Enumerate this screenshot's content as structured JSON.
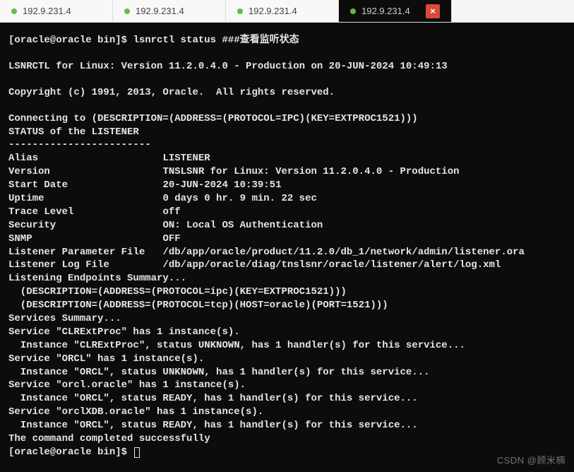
{
  "tabs": [
    {
      "label": "192.9.231.4",
      "active": false
    },
    {
      "label": "192.9.231.4",
      "active": false
    },
    {
      "label": "192.9.231.4",
      "active": false
    },
    {
      "label": "192.9.231.4",
      "active": true
    }
  ],
  "close_glyph": "×",
  "prompt": "[oracle@oracle bin]$ ",
  "command": "lsnrctl status ###查看监听状态",
  "lines": {
    "l1": "LSNRCTL for Linux: Version 11.2.0.4.0 - Production on 20-JUN-2024 10:49:13",
    "l2": "Copyright (c) 1991, 2013, Oracle.  All rights reserved.",
    "l3": "Connecting to (DESCRIPTION=(ADDRESS=(PROTOCOL=IPC)(KEY=EXTPROC1521)))",
    "l4": "STATUS of the LISTENER",
    "l5": "------------------------",
    "r1a": "Alias",
    "r1b": "LISTENER",
    "r2a": "Version",
    "r2b": "TNSLSNR for Linux: Version 11.2.0.4.0 - Production",
    "r3a": "Start Date",
    "r3b": "20-JUN-2024 10:39:51",
    "r4a": "Uptime",
    "r4b": "0 days 0 hr. 9 min. 22 sec",
    "r5a": "Trace Level",
    "r5b": "off",
    "r6a": "Security",
    "r6b": "ON: Local OS Authentication",
    "r7a": "SNMP",
    "r7b": "OFF",
    "r8a": "Listener Parameter File",
    "r8b": "/db/app/oracle/product/11.2.0/db_1/network/admin/listener.ora",
    "r9a": "Listener Log File",
    "r9b": "/db/app/oracle/diag/tnslsnr/oracle/listener/alert/log.xml",
    "l6": "Listening Endpoints Summary...",
    "l7": "  (DESCRIPTION=(ADDRESS=(PROTOCOL=ipc)(KEY=EXTPROC1521)))",
    "l8": "  (DESCRIPTION=(ADDRESS=(PROTOCOL=tcp)(HOST=oracle)(PORT=1521)))",
    "l9": "Services Summary...",
    "l10": "Service \"CLRExtProc\" has 1 instance(s).",
    "l11": "  Instance \"CLRExtProc\", status UNKNOWN, has 1 handler(s) for this service...",
    "l12": "Service \"ORCL\" has 1 instance(s).",
    "l13": "  Instance \"ORCL\", status UNKNOWN, has 1 handler(s) for this service...",
    "l14": "Service \"orcl.oracle\" has 1 instance(s).",
    "l15": "  Instance \"ORCL\", status READY, has 1 handler(s) for this service...",
    "l16": "Service \"orclXDB.oracle\" has 1 instance(s).",
    "l17": "  Instance \"ORCL\", status READY, has 1 handler(s) for this service...",
    "l18": "The command completed successfully"
  },
  "prompt2": "[oracle@oracle bin]$ ",
  "watermark": "CSDN @顾米楠"
}
